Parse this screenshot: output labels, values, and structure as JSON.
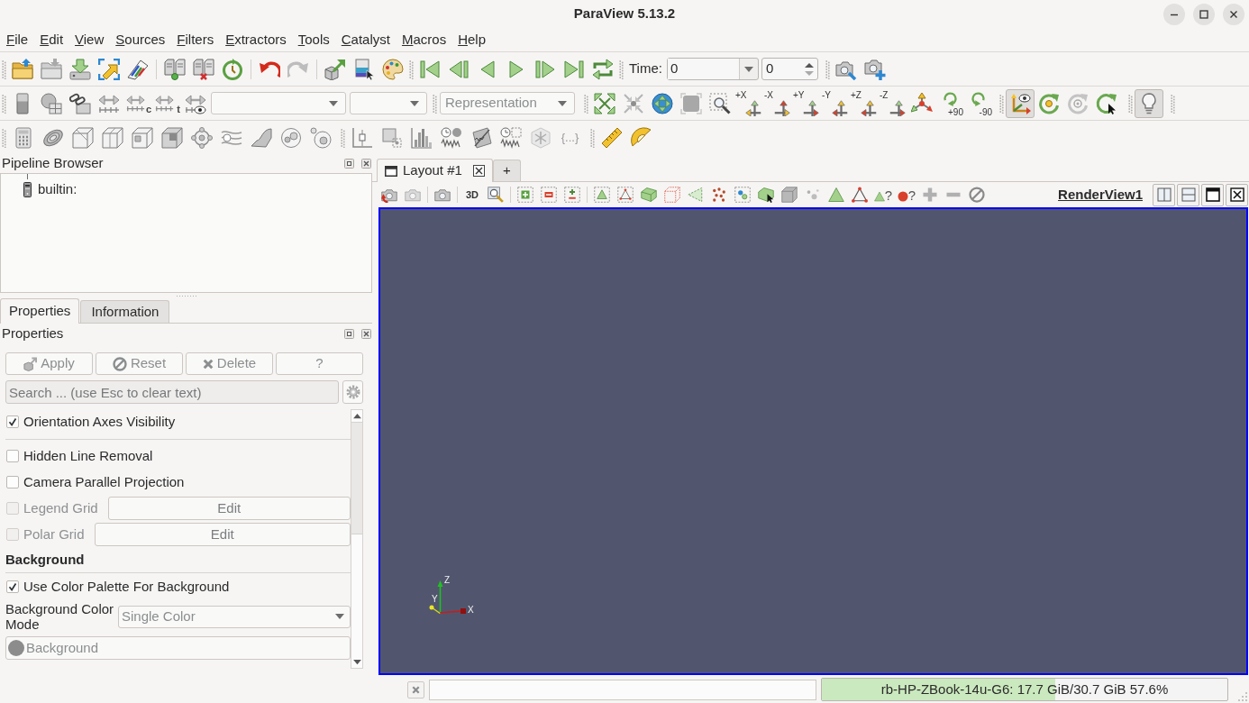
{
  "window": {
    "title": "ParaView 5.13.2"
  },
  "menu_bar": [
    "File",
    "Edit",
    "View",
    "Sources",
    "Filters",
    "Extractors",
    "Tools",
    "Catalyst",
    "Macros",
    "Help"
  ],
  "main_toolbar": {
    "time_label": "Time:",
    "time_value": "0",
    "timestep_value": "0"
  },
  "color_toolbar": {
    "range_marks": [
      "c",
      "t"
    ],
    "representation": {
      "value": "Representation",
      "disabled": true
    }
  },
  "camera_toolbar": {
    "direction_labels": [
      "+X",
      "-X",
      "+Y",
      "-Y",
      "+Z",
      "-Z"
    ],
    "rotate_labels": [
      "+90",
      "-90"
    ],
    "axes_toggle": {
      "pressed": true
    }
  },
  "light_toolbar": {
    "light_toggle": {
      "pressed": true
    }
  },
  "filters_toolbar": {
    "script_label": "{...}"
  },
  "pipeline_browser": {
    "title": "Pipeline Browser",
    "items": [
      {
        "label": "builtin:"
      }
    ]
  },
  "properties_tabs": [
    {
      "label": "Properties",
      "selected": true
    },
    {
      "label": "Information",
      "selected": false
    }
  ],
  "properties_panel": {
    "title": "Properties",
    "buttons": [
      {
        "label": "Apply",
        "disabled": true
      },
      {
        "label": "Reset",
        "disabled": true
      },
      {
        "label": "Delete",
        "disabled": true
      },
      {
        "label": "?",
        "disabled": true
      }
    ],
    "search": {
      "placeholder": "Search ... (use Esc to clear text)"
    },
    "rows": [
      {
        "kind": "checkbox",
        "label": "Orientation Axes Visibility",
        "checked": true,
        "disabled": false
      },
      {
        "kind": "separator"
      },
      {
        "kind": "checkbox",
        "label": "Hidden Line Removal",
        "checked": false,
        "disabled": false
      },
      {
        "kind": "checkbox",
        "label": "Camera Parallel Projection",
        "checked": false,
        "disabled": false
      },
      {
        "kind": "checkbox_with_button",
        "label": "Legend Grid",
        "checked": false,
        "disabled": true,
        "button": "Edit"
      },
      {
        "kind": "checkbox_with_button",
        "label": "Polar Grid",
        "checked": false,
        "disabled": true,
        "button": "Edit"
      },
      {
        "kind": "heading",
        "label": "Background"
      },
      {
        "kind": "checkbox",
        "label": "Use Color Palette For Background",
        "checked": true,
        "disabled": false
      },
      {
        "kind": "combo",
        "label": "Background Color Mode",
        "value": "Single Color",
        "disabled": true
      },
      {
        "kind": "color_button",
        "label": "Background",
        "disabled": true
      }
    ]
  },
  "layout_tabs": [
    {
      "kind": "layout",
      "label": "Layout #1",
      "selected": true
    },
    {
      "kind": "add",
      "label": "+",
      "selected": false
    }
  ],
  "view": {
    "title": "RenderView1",
    "active": true,
    "toolbar": {
      "mode_label": "3D",
      "query_labels": [
        "?",
        "?"
      ]
    },
    "axes_labels": [
      "Z",
      "Y",
      "X"
    ]
  },
  "status_bar": {
    "memory": {
      "label": "rb-HP-ZBook-14u-G6: 17.7 GiB/30.7 GiB 57.6%",
      "level": 0.576
    }
  }
}
